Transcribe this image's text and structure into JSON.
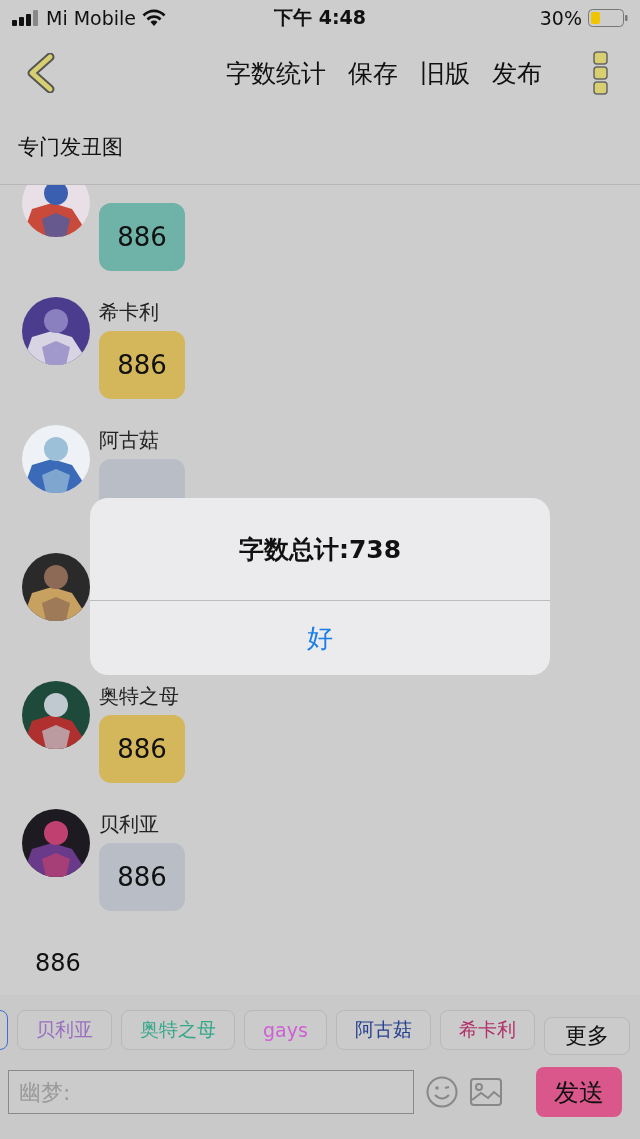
{
  "status_bar": {
    "carrier": "Mi Mobile",
    "time": "下午 4:48",
    "battery": "30%"
  },
  "nav": {
    "actions": [
      "字数统计",
      "保存",
      "旧版",
      "发布"
    ]
  },
  "chat_title": "专门发丑图",
  "messages": [
    {
      "kind": "bubble",
      "bubble": "886",
      "color": "#6fb3a8"
    },
    {
      "kind": "bubble",
      "name": "希卡利",
      "bubble": "886",
      "color": "#d4b75a"
    },
    {
      "kind": "bubble",
      "name": "阿古菇",
      "color": "#b9bdc5"
    },
    {
      "kind": "bubble"
    },
    {
      "kind": "bubble",
      "name": "奥特之母",
      "bubble": "886",
      "color": "#d4b75a"
    },
    {
      "kind": "bubble",
      "name": "贝利亚",
      "bubble": "886",
      "color": "#b9bdc5"
    },
    {
      "kind": "plain",
      "text": "886"
    }
  ],
  "dialog": {
    "message": "字数总计:738",
    "button": "好"
  },
  "quick_tags": [
    {
      "color": "#3b6fd6"
    },
    {
      "label": "贝利亚",
      "color": "#9a6fc2"
    },
    {
      "label": "奥特之母",
      "color": "#35a88a"
    },
    {
      "label": "gays",
      "color": "#cf5fd4"
    },
    {
      "label": "阿古菇",
      "color": "#26408f"
    },
    {
      "label": "希卡利",
      "color": "#b0306a"
    }
  ],
  "more_button": "更多",
  "input": {
    "placeholder": "幽梦:"
  },
  "send_button": "发送"
}
